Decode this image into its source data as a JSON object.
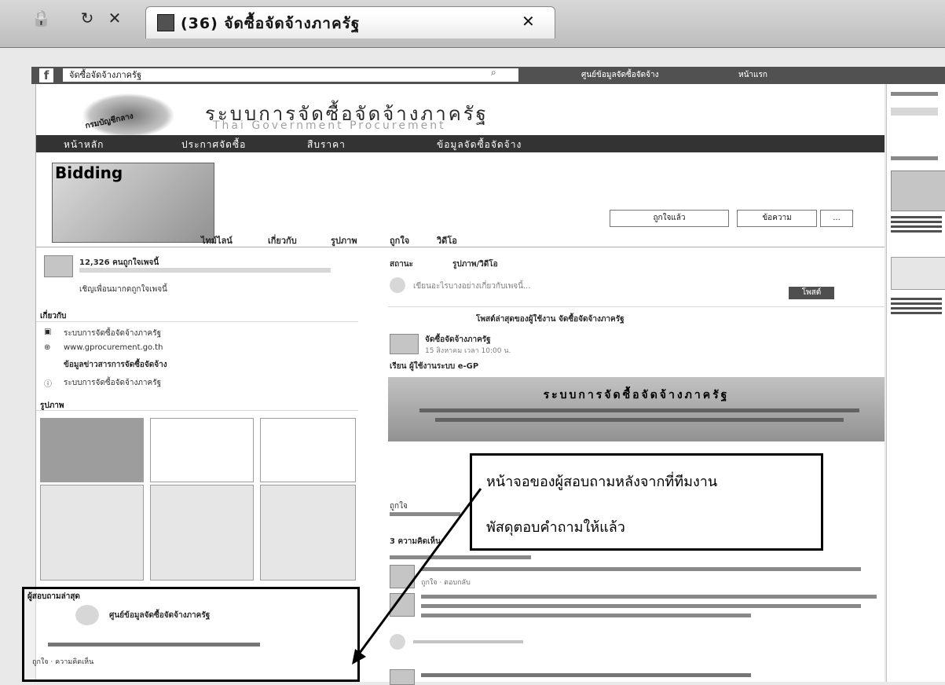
{
  "browser": {
    "nav_icons": [
      "lock-icon",
      "refresh-icon",
      "close-icon"
    ],
    "tab": {
      "title": "(36) จัดซื้อจัดจ้างภาครัฐ",
      "close_glyph": "✕"
    }
  },
  "facebook_bar": {
    "logo": "f",
    "search_value": "จัดซื้อจัดจ้างภาครัฐ",
    "profile_label": "ศูนย์ข้อมูลจัดซื้อจัดจ้าง",
    "home_label": "หน้าแรก"
  },
  "site_header": {
    "title": "ระบบการจัดซื้อจัดจ้างภาครัฐ",
    "subtitle": "Thai Government Procurement",
    "logo_text": "กรมบัญชีกลาง",
    "nav": [
      "หน้าหลัก",
      "ประกาศจัดซื้อ",
      "สืบราคา",
      "ข้อมูลจัดซื้อจัดจ้าง"
    ]
  },
  "page_header": {
    "cover_title": "Bidding",
    "liked_label": "ถูกใจแล้ว",
    "message_label": "ข้อความ",
    "more_label": "...",
    "tabs": [
      "ไทม์ไลน์",
      "เกี่ยวกับ",
      "รูปภาพ",
      "ถูกใจ",
      "วิดีโอ"
    ]
  },
  "left_column": {
    "likes_count": "12,326 คนถูกใจเพจนี้",
    "invite_label": "เชิญเพื่อนมากดถูกใจเพจนี้",
    "about_heading": "เกี่ยวกับ",
    "about_items": [
      "ระบบการจัดซื้อจัดจ้างภาครัฐ",
      "www.gprocurement.go.th",
      "ข้อมูลข่าวสารการจัดซื้อจัดจ้าง",
      "ระบบการจัดซื้อจัดจ้างภาครัฐ"
    ],
    "photos_heading": "รูปภาพ",
    "recent_heading": "ผู้สอบถามล่าสุด",
    "recent_post": "ศูนย์ข้อมูลจัดซื้อจัดจ้างภาครัฐ",
    "recent_actions": "ถูกใจ · ความคิดเห็น"
  },
  "center_column": {
    "composer_tabs": [
      "สถานะ",
      "รูปภาพ/วิดีโอ"
    ],
    "composer_placeholder": "เขียนอะไรบางอย่างเกี่ยวกับเพจนี้...",
    "post_button": "โพสต์",
    "pinned_notice": "โพสต์ล่าสุดของผู้ใช้งาน จัดซื้อจัดจ้างภาครัฐ",
    "post_author": "จัดซื้อจัดจ้างภาครัฐ",
    "post_time": "15 สิงหาคม เวลา 10:00 น.",
    "post_heading": "เรียน ผู้ใช้งานระบบ e-GP",
    "banner_title": "ระบบการจัดซื้อจัดจ้างภาครัฐ",
    "like_label": "ถูกใจ",
    "comments_count": "3 ความคิดเห็น",
    "comment_actions": "ถูกใจ · ตอบกลับ"
  },
  "annotations": {
    "main_callout": [
      "หน้าจอของผู้สอบถามหลังจากที่ทีมงาน",
      "พัสดุตอบคำถามให้แล้ว"
    ]
  }
}
